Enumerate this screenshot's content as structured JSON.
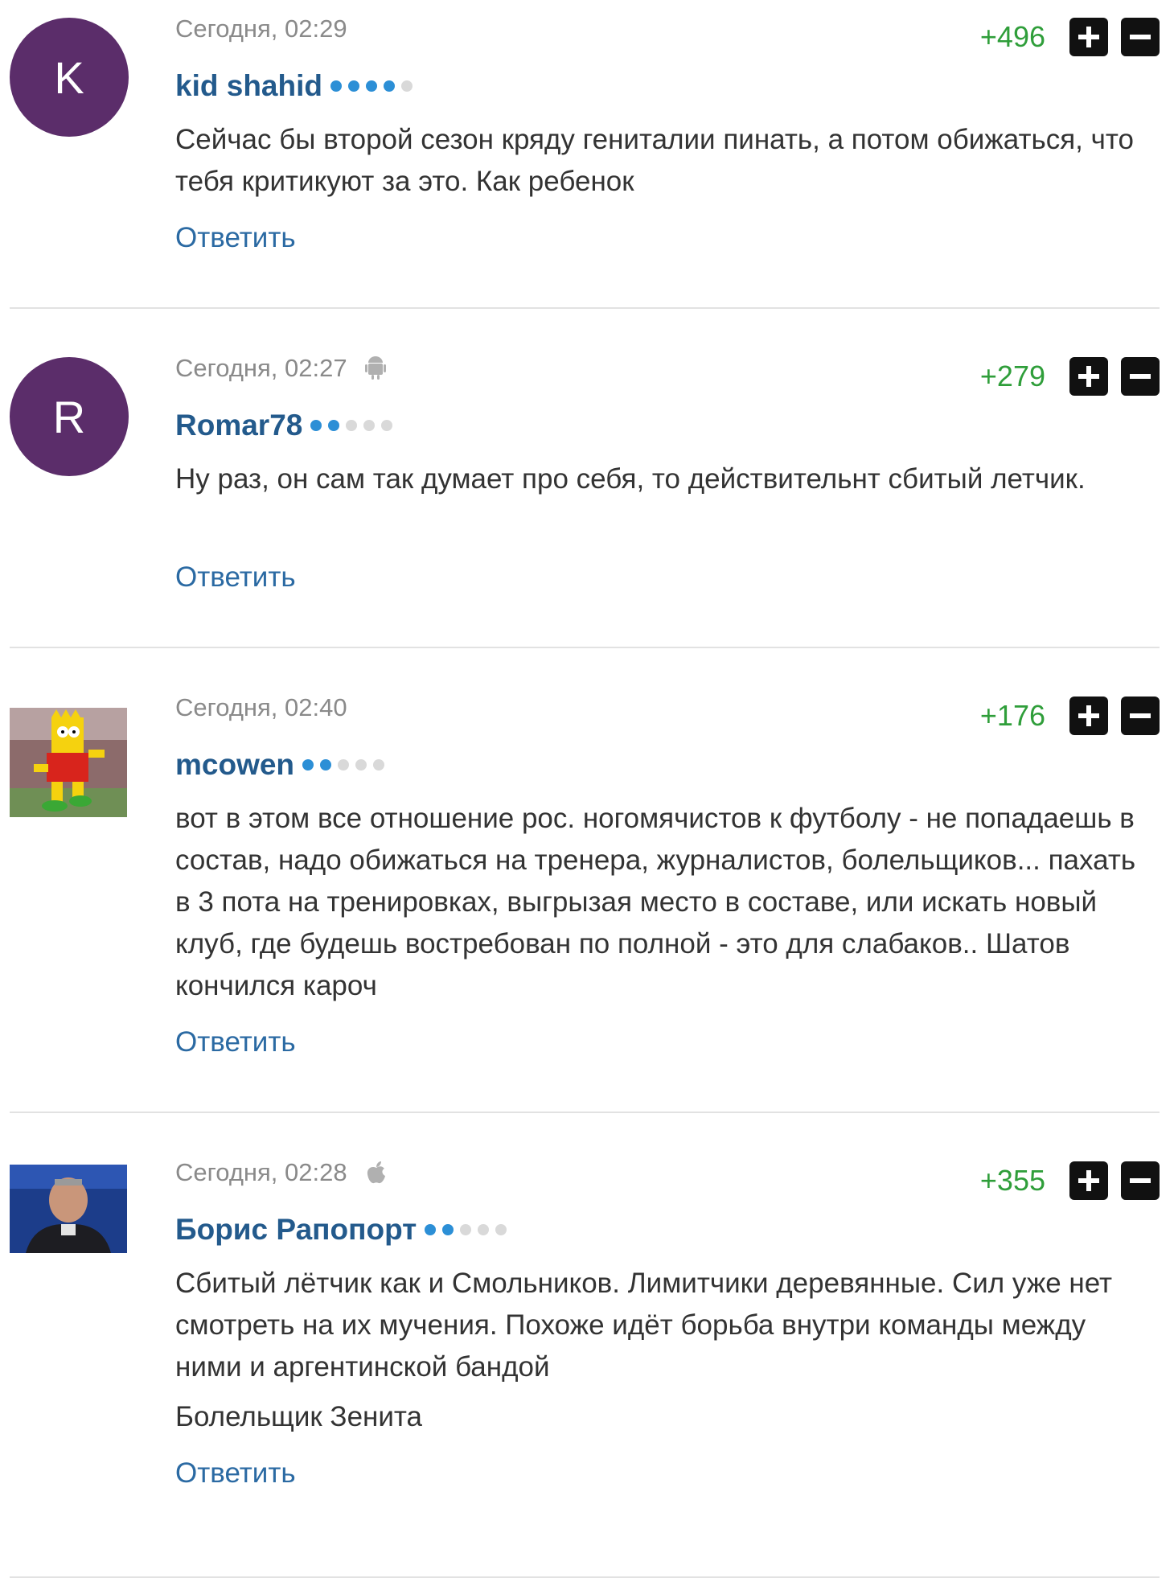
{
  "comments": [
    {
      "avatar_letter": "K",
      "time": "Сегодня, 02:29",
      "author": "kid shahid",
      "rating_on": 4,
      "score": "+496",
      "text": "Сейчас бы второй сезон кряду гениталии пинать, а потом обижаться, что тебя критикуют за это. Как ребенок",
      "reply": "Ответить"
    },
    {
      "avatar_letter": "R",
      "time": "Сегодня, 02:27",
      "device_icon": "android-icon",
      "author": "Romar78",
      "rating_on": 2,
      "score": "+279",
      "text": "Ну раз, он сам так думает про себя, то действительнт сбитый летчик.",
      "reply": "Ответить"
    },
    {
      "time": "Сегодня, 02:40",
      "author": "mcowen",
      "rating_on": 2,
      "score": "+176",
      "text": "вот в этом все отношение рос. ногомячистов к футболу - не попадаешь в состав, надо обижаться на тренера, журналистов, болельщиков... пахать в 3 пота на тренировках, выгрызая место в составе, или искать новый клуб, где будешь востребован по полной - это для слабаков.. Шатов кончился кароч",
      "reply": "Ответить"
    },
    {
      "time": "Сегодня, 02:28",
      "device_icon": "apple-icon",
      "author": "Борис Рапопорт",
      "rating_on": 2,
      "score": "+355",
      "text": "Сбитый лётчик как и Смольников. Лимитчики деревянные. Сил уже нет смотреть на их мучения. Похоже идёт борьба внутри команды между ними и аргентинской бандой",
      "signature": "Болельщик Зенита",
      "reply": "Ответить"
    }
  ],
  "colors": {
    "score": "#2f9e3a",
    "author": "#235a8c",
    "reply": "#2b6aa3",
    "rating_on": "#2c8fd6",
    "rating_off": "#d9d9d9",
    "avatar_bg": "#5b2d6a"
  }
}
